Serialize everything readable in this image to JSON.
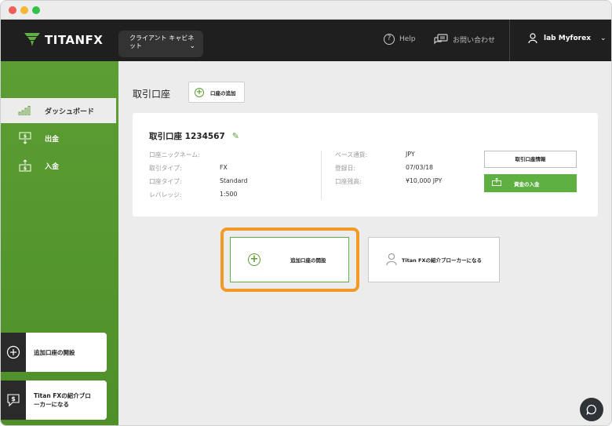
{
  "header": {
    "logo_text": "TITANFX",
    "client_select_label": "クライアント キャビネット",
    "help_label": "Help",
    "contact_label": "お問い合わせ",
    "user_name": "lab Myforex"
  },
  "sidebar": {
    "items": [
      {
        "label": "ダッシュボード",
        "icon": "bar-chart-icon",
        "active": true
      },
      {
        "label": "出金",
        "icon": "withdraw-icon",
        "active": false
      },
      {
        "label": "入金",
        "icon": "deposit-icon",
        "active": false
      }
    ],
    "cards": [
      {
        "label": "追加口座の開設",
        "icon": "plus-circle-icon"
      },
      {
        "label": "Titan FXの紹介ブローカーになる",
        "icon": "dollar-chat-icon"
      }
    ]
  },
  "main": {
    "page_title": "取引口座",
    "add_account_button": "口座の追加",
    "account": {
      "title": "取引口座 1234567",
      "left": [
        {
          "key": "口座ニックネーム:",
          "value": ""
        },
        {
          "key": "取引タイプ:",
          "value": "FX"
        },
        {
          "key": "口座タイプ:",
          "value": "Standard"
        },
        {
          "key": "レバレッジ:",
          "value": "1:500"
        }
      ],
      "right": [
        {
          "key": "ベース通貨:",
          "value": "JPY"
        },
        {
          "key": "登録日:",
          "value": "07/03/18"
        },
        {
          "key": "口座残高:",
          "value": "¥10,000 JPY"
        }
      ],
      "info_button": "取引口座情報",
      "fund_button": "資金の入金"
    },
    "open_account_card": "追加口座の開設",
    "ib_card": "Titan FXの紹介ブローカーになる"
  },
  "colors": {
    "brand_green": "#5c9e33",
    "button_green": "#5fb043",
    "highlight_orange": "#f29a26",
    "topnav_bg": "#1f1f1f"
  }
}
